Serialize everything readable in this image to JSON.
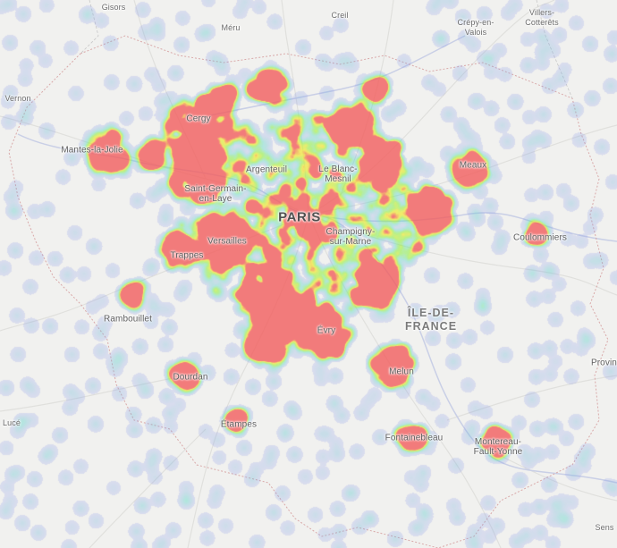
{
  "map": {
    "labels": {
      "gisors": "Gisors",
      "meru": "Méru",
      "creil": "Creil",
      "crepy": "Crépy-en-\nValois",
      "villers": "Villers-\nCotterêts",
      "vernon": "Vernon",
      "cergy": "Cergy",
      "mantes": "Mantes-la-Jolie",
      "argenteuil": "Argenteuil",
      "blancmesnil": "Le Blanc-\nMesnil",
      "meaux": "Meaux",
      "saintgermain": "Saint-Germain-\nen-Laye",
      "paris": "PARIS",
      "champigny": "Champigny-\nsur-Marne",
      "versailles": "Versailles",
      "coulommiers": "Coulommiers",
      "trappes": "Trappes",
      "rambouillet": "Rambouillet",
      "iledefrance": "ÎLE-DE-\nFRANCE",
      "evry": "Évry",
      "provins": "Provins",
      "melun": "Melun",
      "dourdan": "Dourdan",
      "luce": "Lucé",
      "etampes": "Étampes",
      "fontainebleau": "Fontainebleau",
      "montereau": "Montereau-\nFault-Yonne",
      "sens": "Sens"
    },
    "heat_colors": {
      "low": "#8d8ff0",
      "mid_low": "#5fd8c8",
      "mid": "#8ff03c",
      "mid_high": "#f2e830",
      "high": "#f25b5b"
    }
  }
}
